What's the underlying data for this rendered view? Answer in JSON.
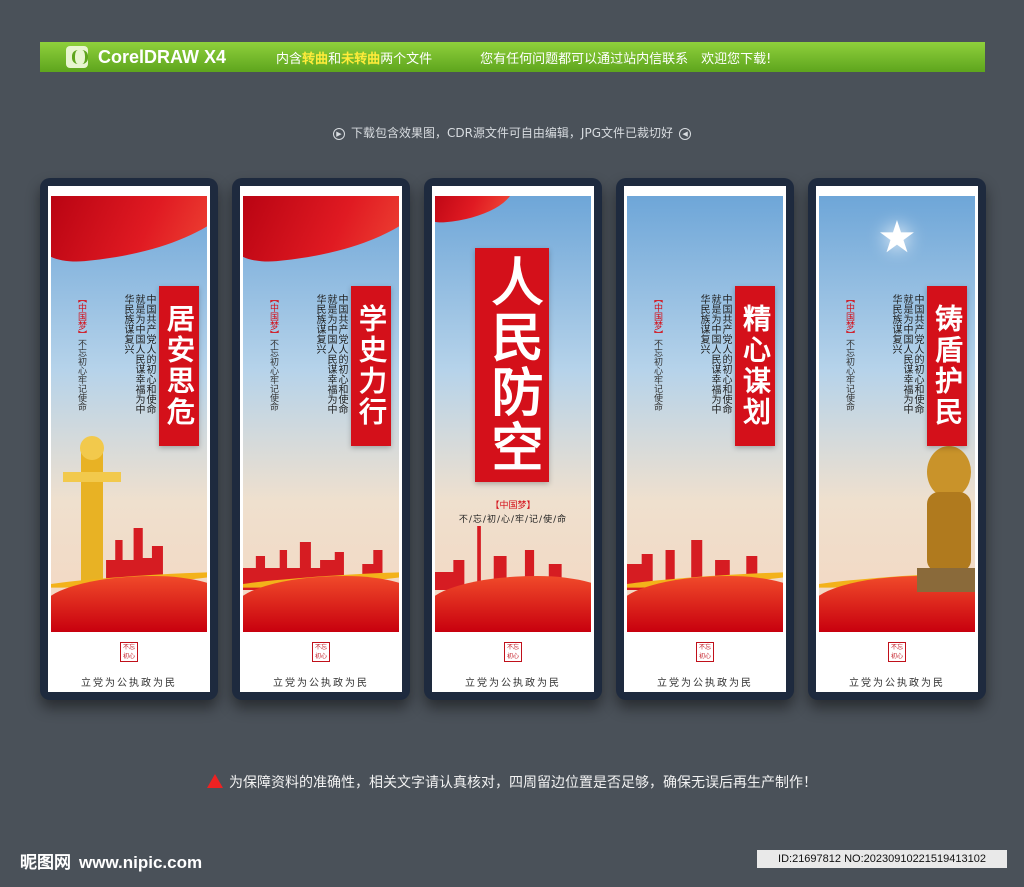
{
  "topbar": {
    "brand": "CorelDRAW X4",
    "intro_prefix": "内含",
    "hl1": "转曲",
    "mid": "和",
    "hl2": "未转曲",
    "intro_suffix": "两个文件",
    "notice": "您有任何问题都可以通过站内信联系　欢迎您下载!"
  },
  "subline": "下载包含效果图，CDR源文件可自由编辑，JPG文件已裁切好",
  "panels": [
    {
      "title": "居安思危",
      "poem": "中国共产党人的初心和使命就是为中国人民谋幸福为中华民族谋复兴",
      "dream": "【中国梦】",
      "slogan": "不忘初心牢记使命",
      "seal": "不忘初心",
      "bottom": "立党为公执政为民"
    },
    {
      "title": "学史力行",
      "poem": "中国共产党人的初心和使命就是为中国人民谋幸福为中华民族谋复兴",
      "dream": "【中国梦】",
      "slogan": "不忘初心牢记使命",
      "seal": "不忘初心",
      "bottom": "立党为公执政为民"
    },
    {
      "title": "人民防空",
      "poem": "",
      "dream": "【中国梦】",
      "slogan": "不/忘/初/心/牢/记/使/命",
      "seal": "不忘初心",
      "bottom": "立党为公执政为民"
    },
    {
      "title": "精心谋划",
      "poem": "中国共产党人的初心和使命就是为中国人民谋幸福为中华民族谋复兴",
      "dream": "【中国梦】",
      "slogan": "不忘初心牢记使命",
      "seal": "不忘初心",
      "bottom": "立党为公执政为民"
    },
    {
      "title": "铸盾护民",
      "poem": "中国共产党人的初心和使命就是为中国人民谋幸福为中华民族谋复兴",
      "dream": "【中国梦】",
      "slogan": "不忘初心牢记使命",
      "seal": "不忘初心",
      "bottom": "立党为公执政为民"
    }
  ],
  "warning": "为保障资料的准确性，相关文字请认真核对，四周留边位置是否足够，确保无误后再生产制作！",
  "footer": {
    "site": "昵图网",
    "url": "www.nipic.com",
    "id": "ID:21697812 NO:20230910221519413102"
  },
  "colors": {
    "bg": "#4a5159",
    "green": "#6ab523",
    "red": "#d4101a",
    "frame": "#1e2a3e"
  }
}
